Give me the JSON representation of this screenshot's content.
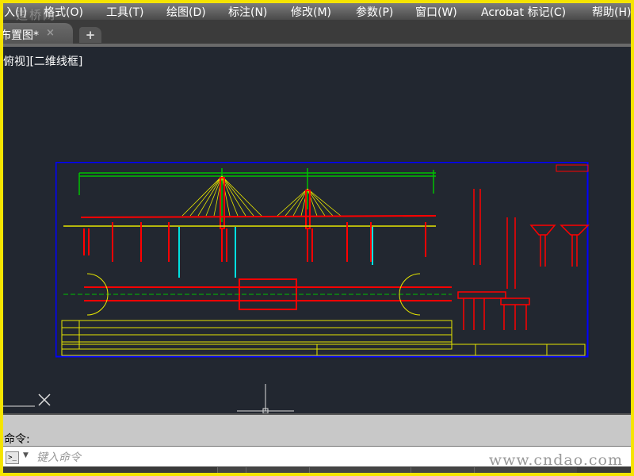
{
  "menubar": {
    "items": [
      "入(I)",
      "格式(O)",
      "工具(T)",
      "绘图(D)",
      "标注(N)",
      "修改(M)",
      "参数(P)",
      "窗口(W)",
      "Acrobat 标记(C)",
      "帮助(H)"
    ]
  },
  "watermark_logo": "道桥网",
  "tabs": {
    "active": "布置图*",
    "close": "×",
    "add": "+"
  },
  "viewport": {
    "label": "俯视][二维线框]"
  },
  "command": {
    "history_label": "命令:",
    "prompt_icon": ">_",
    "placeholder": "键入命令"
  },
  "site_watermark": "www.cndao.com",
  "colors": {
    "canvas": "#222730",
    "border": "#0000ff",
    "red": "#ff0000",
    "yellow": "#e6e600",
    "green": "#00c000",
    "cyan": "#00e0e0",
    "frame": "#f5e400"
  }
}
